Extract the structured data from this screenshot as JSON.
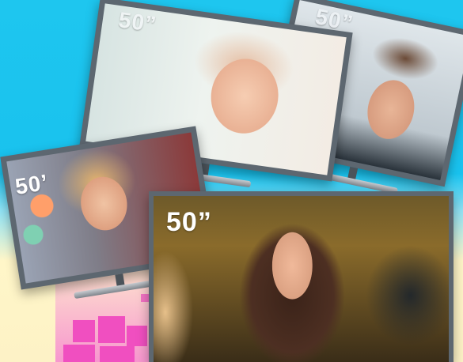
{
  "scene": {
    "description_colors": {
      "sky": "#1ec6ef",
      "cream": "#fdf2c6",
      "pink": "#f04fc0",
      "tv_frame": "#5d6770"
    }
  },
  "tvs": [
    {
      "id": "baby-tv",
      "size_label": "50”"
    },
    {
      "id": "man-tv",
      "size_label": "50”"
    },
    {
      "id": "girl-tv",
      "size_label": "50’"
    },
    {
      "id": "woman-tv",
      "size_label": "50”"
    }
  ]
}
